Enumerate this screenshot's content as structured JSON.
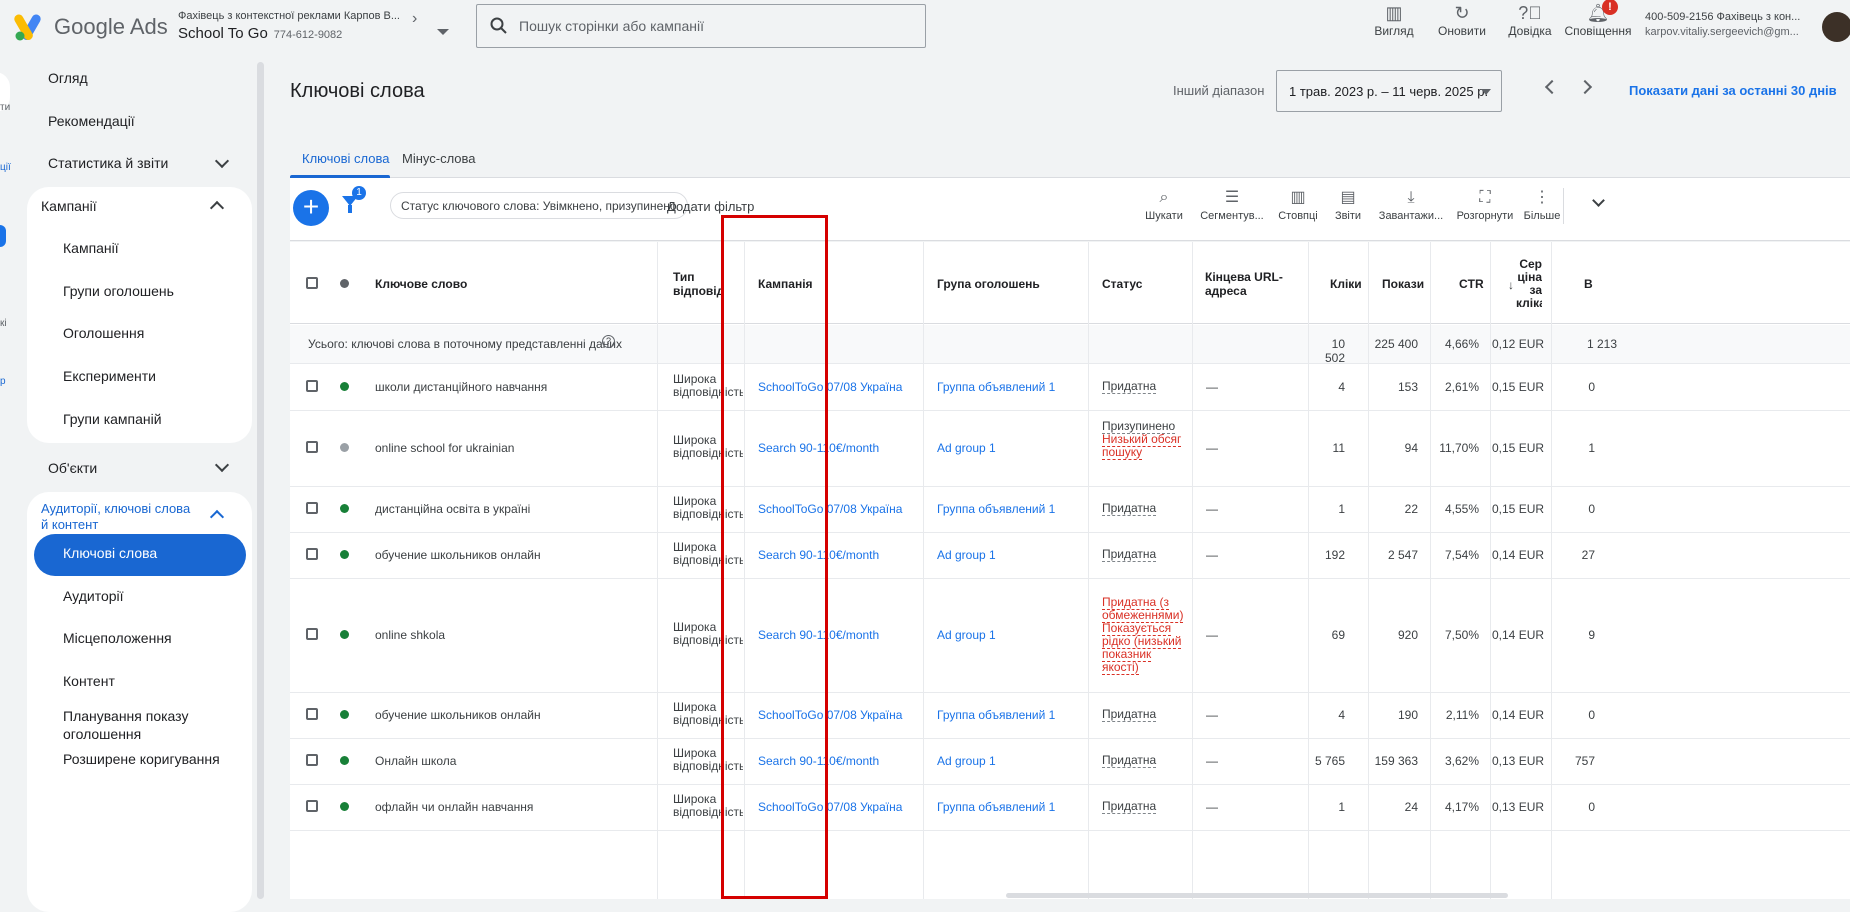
{
  "header": {
    "brand": "Google Ads",
    "account_line1": "Фахівець з контекстної реклами Карпов В...",
    "account_name": "School To Go",
    "account_id": "774-612-9082",
    "search_placeholder": "Пошук сторінки або кампанії",
    "tools": [
      {
        "label": "Вигляд",
        "icon": "view-icon"
      },
      {
        "label": "Оновити",
        "icon": "refresh-icon"
      },
      {
        "label": "Довідка",
        "icon": "help-icon"
      },
      {
        "label": "Сповіщення",
        "icon": "bell-icon"
      }
    ],
    "notif_count": "!",
    "user_line1": "400-509-2156 Фахівець з кон...",
    "user_line2": "karpov.vitaliy.sergeevich@gm..."
  },
  "rail": [
    "ти",
    "ції",
    "кі",
    "р"
  ],
  "sidebar": {
    "overview": "Огляд",
    "recommendations": "Рекомендації",
    "stats": "Статистика й звіти",
    "campaigns_group": "Кампанії",
    "campaign_items": [
      "Кампанії",
      "Групи оголошень",
      "Оголошення",
      "Експерименти",
      "Групи кампаній"
    ],
    "assets": "Об'єкти",
    "audiences_group": "Аудиторії, ключові слова й контент",
    "audience_items": [
      "Ключові слова",
      "Аудиторії",
      "Місцеположення",
      "Контент",
      "Планування показу оголошення",
      "Розширене коригування"
    ]
  },
  "page": {
    "title": "Ключові слова",
    "date_label": "Інший діапазон",
    "date_range": "1 трав. 2023 р. – 11 черв. 2025 р.",
    "last30": "Показати дані за останні 30 днів"
  },
  "tabs": [
    "Ключові слова",
    "Мінус-слова"
  ],
  "toolbar": {
    "filter_count": "1",
    "chip": "Статус ключового слова: Увімкнено, призупинено",
    "add_filter": "Додати фільтр",
    "tools": [
      "Шукати",
      "Сегментув...",
      "Стовпці",
      "Звіти",
      "Завантажи...",
      "Розгорнути",
      "Більше"
    ]
  },
  "columns": {
    "keyword": "Ключове слово",
    "match": "Тип відповідн",
    "campaign": "Кампанія",
    "adgroup": "Група оголошень",
    "status": "Статус",
    "url": "Кінцева URL-адреса",
    "clicks": "Кліки",
    "impr": "Покази",
    "ctr": "CTR",
    "cpc": "Сер ціна за кліка",
    "cost": "В"
  },
  "totals": {
    "label": "Усього: ключові слова в поточному представленні даних",
    "clicks": "10 502",
    "impr": "225 400",
    "ctr": "4,66%",
    "cpc": "0,12 EUR",
    "cost": "1 213"
  },
  "rows": [
    {
      "kw": "школи дистанційного навчання",
      "match": "Широка відповідність",
      "camp": "SchoolToGo 07/08 Україна",
      "ag": "Группа объявлений 1",
      "status": "Придатна",
      "url": "—",
      "clicks": "4",
      "impr": "153",
      "ctr": "2,61%",
      "cpc": "0,15 EUR",
      "cost": "0"
    },
    {
      "kw": "online school for ukrainian",
      "match": "Широка відповідність",
      "camp": "Search 90-110€/month",
      "ag": "Ad group 1",
      "status": "Призупинено",
      "status2": "Низький обсяг пошуку",
      "url": "—",
      "clicks": "11",
      "impr": "94",
      "ctr": "11,70%",
      "cpc": "0,15 EUR",
      "cost": "1"
    },
    {
      "kw": "дистанційна освіта в україні",
      "match": "Широка відповідність",
      "camp": "SchoolToGo 07/08 Україна",
      "ag": "Группа объявлений 1",
      "status": "Придатна",
      "url": "—",
      "clicks": "1",
      "impr": "22",
      "ctr": "4,55%",
      "cpc": "0,15 EUR",
      "cost": "0"
    },
    {
      "kw": "обучение школьников онлайн",
      "match": "Широка відповідність",
      "camp": "Search 90-110€/month",
      "ag": "Ad group 1",
      "status": "Придатна",
      "url": "—",
      "clicks": "192",
      "impr": "2 547",
      "ctr": "7,54%",
      "cpc": "0,14 EUR",
      "cost": "27"
    },
    {
      "kw": "online shkola",
      "match": "Широка відповідність",
      "camp": "Search 90-110€/month",
      "ag": "Ad group 1",
      "status": "Придатна (з обмеженнями)",
      "status2": "Показується рідко (низький показник якості)",
      "url": "—",
      "clicks": "69",
      "impr": "920",
      "ctr": "7,50%",
      "cpc": "0,14 EUR",
      "cost": "9"
    },
    {
      "kw": "обучение школьников онлайн",
      "match": "Широка відповідність",
      "camp": "SchoolToGo 07/08 Україна",
      "ag": "Группа объявлений 1",
      "status": "Придатна",
      "url": "—",
      "clicks": "4",
      "impr": "190",
      "ctr": "2,11%",
      "cpc": "0,14 EUR",
      "cost": "0"
    },
    {
      "kw": "Онлайн школа",
      "match": "Широка відповідність",
      "camp": "Search 90-110€/month",
      "ag": "Ad group 1",
      "status": "Придатна",
      "url": "—",
      "clicks": "5 765",
      "impr": "159 363",
      "ctr": "3,62%",
      "cpc": "0,13 EUR",
      "cost": "757"
    },
    {
      "kw": "офлайн чи онлайн навчання",
      "match": "Широка відповідність",
      "camp": "SchoolToGo 07/08 Україна",
      "ag": "Группа объявлений 1",
      "status": "Придатна",
      "url": "—",
      "clicks": "1",
      "impr": "24",
      "ctr": "4,17%",
      "cpc": "0,13 EUR",
      "cost": "0"
    }
  ]
}
